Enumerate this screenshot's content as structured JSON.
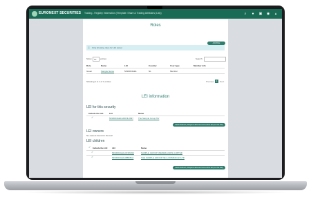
{
  "header": {
    "brand": "EURONEXT SECURITIES",
    "page_title": "Trading - Registry Information (Template: Share & Trading Attributes (List))",
    "icons": [
      "search-icon",
      "user-icon",
      "document-icon",
      "eye-icon",
      "bell-icon"
    ]
  },
  "roles": {
    "title": "Roles",
    "add_button": "Add Role",
    "info_text": "Only showing roles for LEI owner",
    "show_label": "Show",
    "show_value": "10",
    "entries_label": "entries",
    "search_label": "Search:",
    "columns": [
      "Role",
      "Name",
      "LEI",
      "Country",
      "User type",
      "Member info"
    ],
    "rows": [
      {
        "role": "Issuer",
        "name": "Sample Name",
        "lei": "5493004GE1",
        "country": "NL",
        "user_type": "Member",
        "member_info": ""
      }
    ],
    "showing_text": "Showing 1 to 1 of 1 entries",
    "pager_prev": "Previous",
    "pager_page": "1",
    "pager_next": "Next"
  },
  "lei": {
    "title": "LEI information",
    "security_section": "LEI for this security",
    "security_columns": [
      "Include the LEI",
      "LEI",
      "Name"
    ],
    "security_rows": [
      {
        "lei": "5493004GE1GDDNL3097",
        "name": "The Sample Group NV"
      }
    ],
    "security_button": "Fetch Refresh, Request data and renew this list (for this LEI)",
    "owners_section": "LEI owners",
    "owners_empty": "No owners found for this LEI",
    "children_section": "LEI children",
    "children_columns": [
      "Include the LEI",
      "LEI",
      "Name"
    ],
    "children_rows": [
      {
        "lei": "5493004GE1LDN3M4Q",
        "name": "SAMPLE GROUP (NEDERLANDS) LIMITED"
      },
      {
        "lei": "5493004GE1HBBF8G2",
        "name": "THE SAMPLE GROUP NE & DOMINICAN LTD"
      }
    ],
    "children_button": "Fetch Refresh, Request data and renew this list (for this LEI)"
  }
}
